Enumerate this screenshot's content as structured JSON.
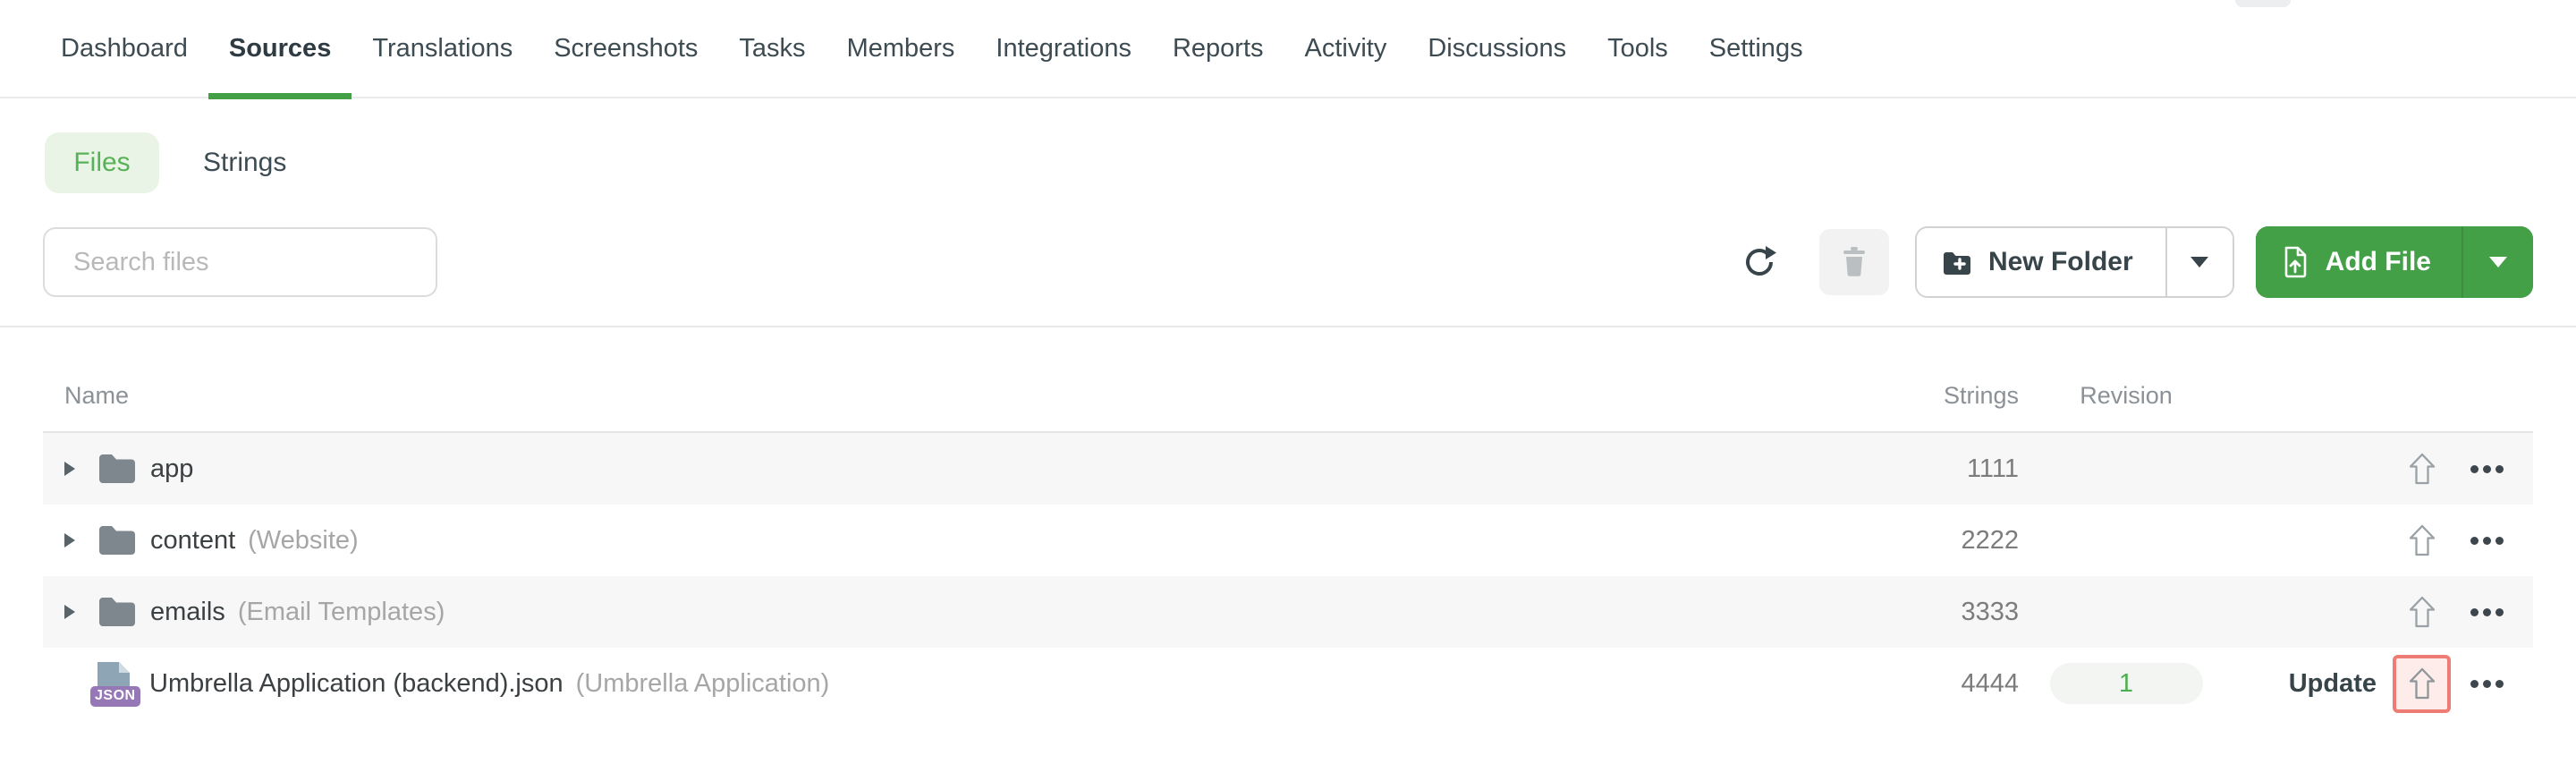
{
  "nav": {
    "items": [
      {
        "label": "Dashboard",
        "active": false
      },
      {
        "label": "Sources",
        "active": true
      },
      {
        "label": "Translations",
        "active": false
      },
      {
        "label": "Screenshots",
        "active": false
      },
      {
        "label": "Tasks",
        "active": false
      },
      {
        "label": "Members",
        "active": false
      },
      {
        "label": "Integrations",
        "active": false
      },
      {
        "label": "Reports",
        "active": false
      },
      {
        "label": "Activity",
        "active": false
      },
      {
        "label": "Discussions",
        "active": false
      },
      {
        "label": "Tools",
        "active": false
      },
      {
        "label": "Settings",
        "active": false
      }
    ]
  },
  "view_tabs": {
    "files_label": "Files",
    "strings_label": "Strings"
  },
  "search": {
    "placeholder": "Search files",
    "value": ""
  },
  "toolbar": {
    "new_folder_label": "New Folder",
    "add_file_label": "Add File"
  },
  "table": {
    "headers": {
      "name": "Name",
      "strings": "Strings",
      "revision": "Revision"
    },
    "rows": [
      {
        "kind": "folder",
        "name": "app",
        "note": "",
        "strings": "1111",
        "revision": "",
        "update_label": ""
      },
      {
        "kind": "folder",
        "name": "content",
        "note": "(Website)",
        "strings": "2222",
        "revision": "",
        "update_label": ""
      },
      {
        "kind": "folder",
        "name": "emails",
        "note": "(Email Templates)",
        "strings": "3333",
        "revision": "",
        "update_label": ""
      },
      {
        "kind": "file",
        "badge": "JSON",
        "name": "Umbrella Application (backend).json",
        "note": "(Umbrella Application)",
        "strings": "4444",
        "revision": "1",
        "update_label": "Update"
      }
    ]
  },
  "colors": {
    "accent_green": "#43a047",
    "files_tab_text": "#57b257",
    "files_tab_bg": "#e9f4e7",
    "row_stripe": "#f7f7f8",
    "revision_text": "#4caf50",
    "highlight_border": "#ed7d74",
    "highlight_bg": "#fdecea",
    "json_badge_bg": "#9678b6"
  },
  "icons": [
    "refresh-icon",
    "trash-icon",
    "folder-plus-icon",
    "file-upload-icon",
    "caret-down-icon",
    "chevron-right-icon",
    "folder-icon",
    "json-file-icon",
    "upload-icon",
    "ellipsis-icon"
  ]
}
